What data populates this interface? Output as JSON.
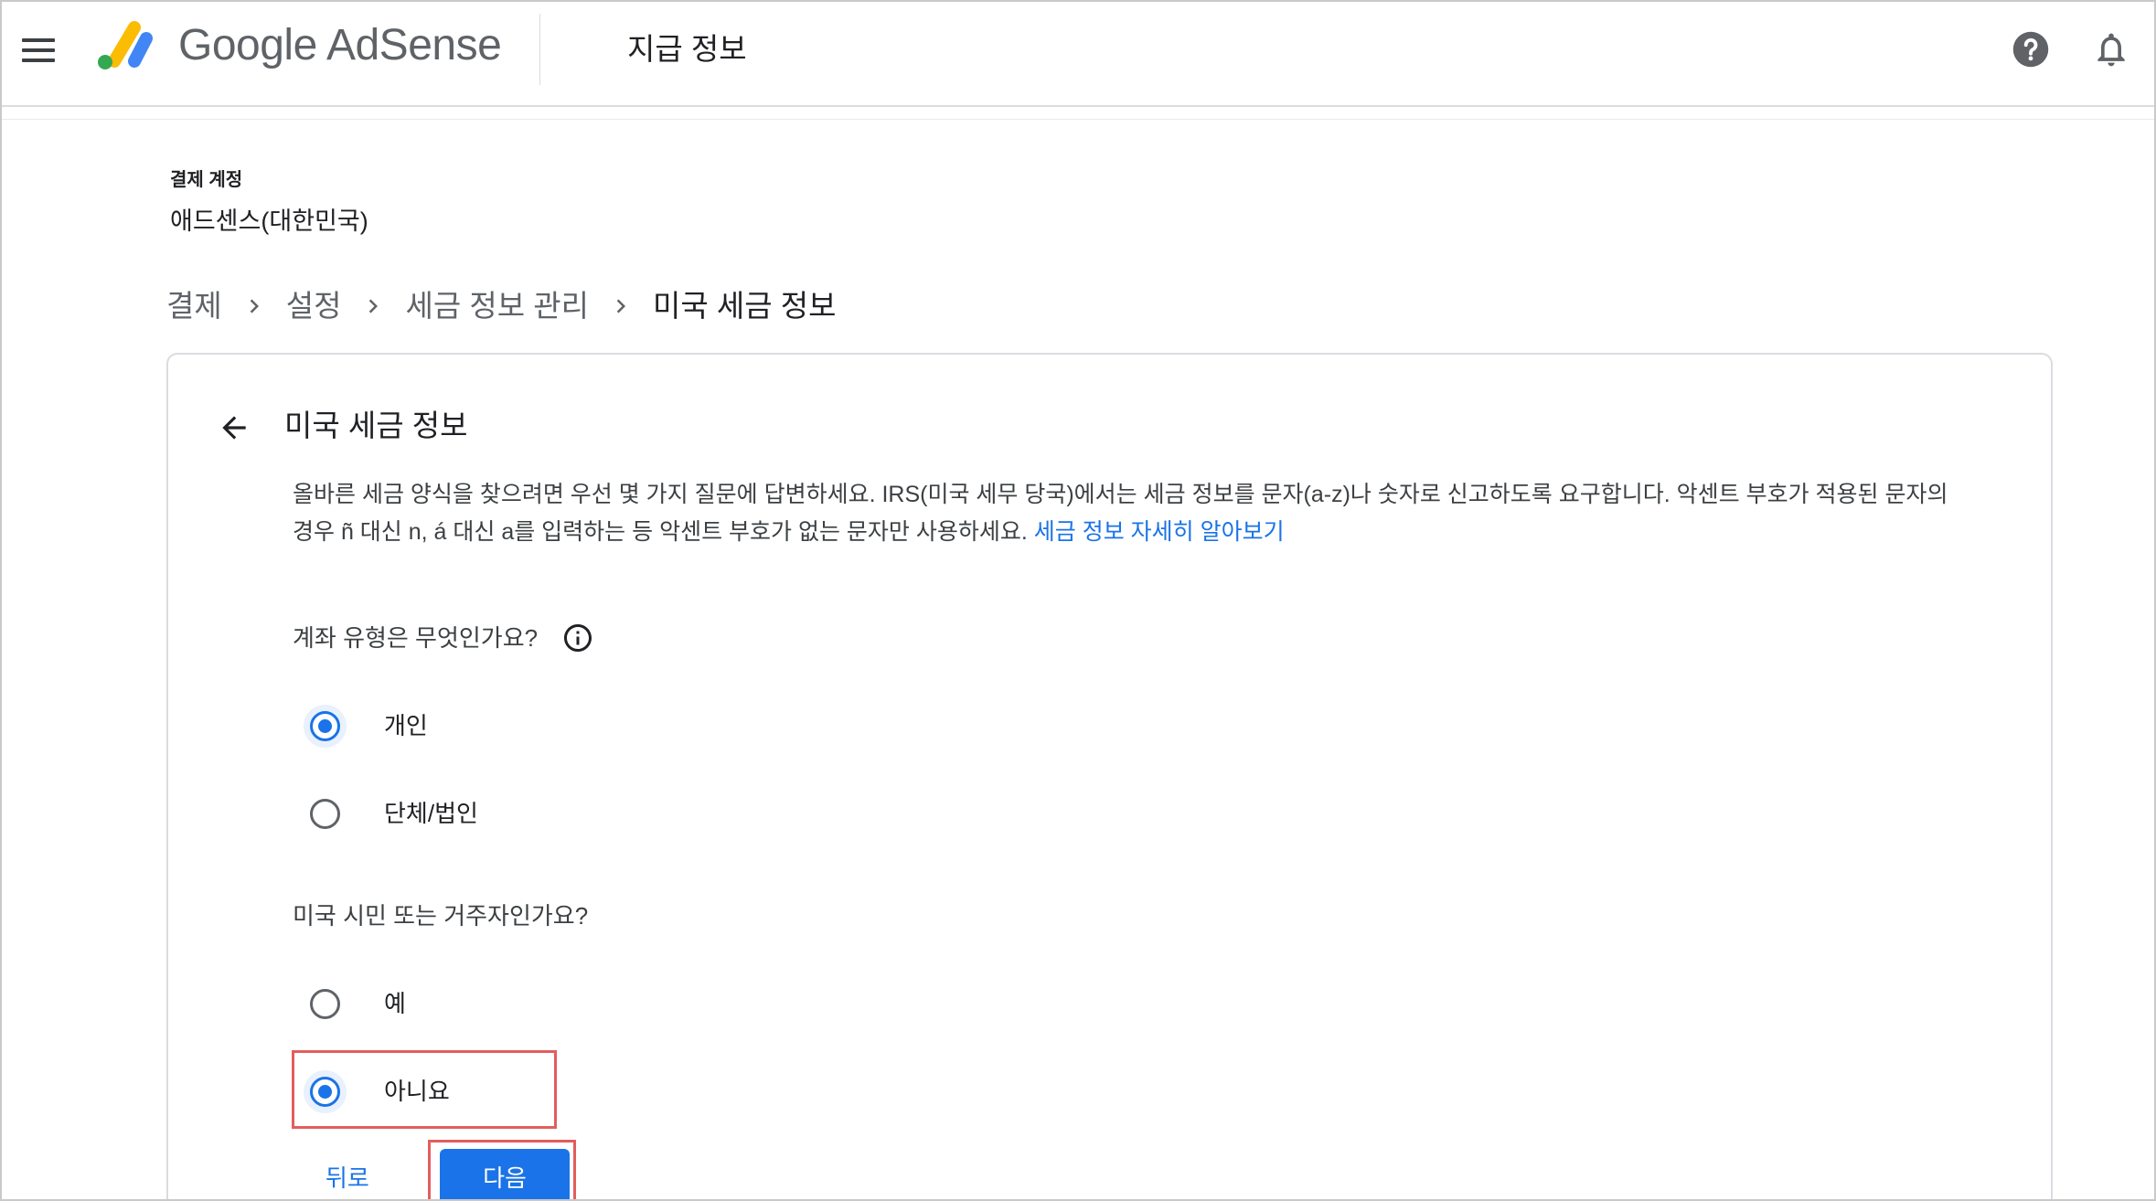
{
  "colors": {
    "accent": "#1a73e8",
    "highlight": "#e35d5d",
    "text": "#202124",
    "secondary_text": "#5f6368"
  },
  "header": {
    "menu_icon": "menu-icon",
    "logo_icon": "adsense-logo-icon",
    "brand": "Google AdSense",
    "page_title": "지급 정보",
    "help_icon": "help-icon",
    "notifications_icon": "bell-icon"
  },
  "account": {
    "label": "결제 계정",
    "name": "애드센스(대한민국)"
  },
  "breadcrumb": {
    "separator_icon": "chevron-right-icon",
    "items": [
      {
        "label": "결제"
      },
      {
        "label": "설정"
      },
      {
        "label": "세금 정보 관리"
      },
      {
        "label": "미국 세금 정보",
        "current": true
      }
    ]
  },
  "card": {
    "back_icon": "arrow-back-icon",
    "title": "미국 세금 정보",
    "description": "올바른 세금 양식을 찾으려면 우선 몇 가지 질문에 답변하세요. IRS(미국 세무 당국)에서는 세금 정보를 문자(a-z)나 숫자로 신고하도록 요구합니다. 악센트 부호가 적용된 문자의 경우 ñ 대신 n, á 대신 a를 입력하는 등 악센트 부호가 없는 문자만 사용하세요.",
    "learn_more_link": "세금 정보 자세히 알아보기",
    "account_type": {
      "question": "계좌 유형은 무엇인가요?",
      "info_icon": "info-icon",
      "options": [
        {
          "label": "개인",
          "selected": true
        },
        {
          "label": "단체/법인",
          "selected": false
        }
      ]
    },
    "us_person": {
      "question": "미국 시민 또는 거주자인가요?",
      "options": [
        {
          "label": "예",
          "selected": false
        },
        {
          "label": "아니요",
          "selected": true
        }
      ]
    },
    "actions": {
      "back_label": "뒤로",
      "next_label": "다음"
    }
  }
}
